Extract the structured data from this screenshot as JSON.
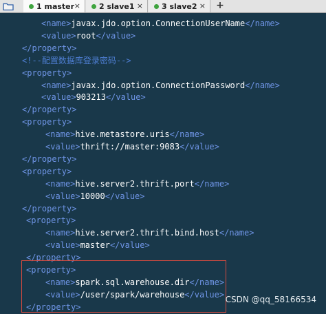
{
  "tabs": [
    {
      "label": "1 master",
      "close": "×"
    },
    {
      "label": "2 slave1",
      "close": "×"
    },
    {
      "label": "3 slave2",
      "close": "×"
    }
  ],
  "add_tab": "+",
  "code_lines": [
    [
      "<name>",
      "javax.jdo.option.ConnectionUserName",
      "</name>"
    ],
    [
      "<value>",
      "root",
      "</value>"
    ],
    [
      "</property>"
    ],
    [
      "<!--配置数据库登录密码-->"
    ],
    [
      "<property>"
    ],
    [
      "<name>",
      "javax.jdo.option.ConnectionPassword",
      "</name>"
    ],
    [
      "<value>",
      "903213",
      "</value>"
    ],
    [
      "</property>"
    ],
    [
      "<property>"
    ],
    [
      "<name>",
      "hive.metastore.uris",
      "</name>"
    ],
    [
      "<value>",
      "thrift://master:9083",
      "</value>"
    ],
    [
      "</property>"
    ],
    [
      "<property>"
    ],
    [
      "<name>",
      "hive.server2.thrift.port",
      "</name>"
    ],
    [
      "<value>",
      "10000",
      "</value>"
    ],
    [
      "</property>"
    ],
    [
      "<property>"
    ],
    [
      "<name>",
      "hive.server2.thrift.bind.host",
      "</name>"
    ],
    [
      "<value>",
      "master",
      "</value>"
    ],
    [
      "</property>"
    ],
    [
      "<property>"
    ],
    [
      "<name>",
      "spark.sql.warehouse.dir",
      "</name>"
    ],
    [
      "<value>",
      "/user/spark/warehouse",
      "</value>"
    ],
    [
      "</property>"
    ]
  ],
  "watermark": "CSDN @qq_58166534",
  "colors": {
    "background": "#19384a",
    "tag": "#6f95e6",
    "text": "#ffffff",
    "comment": "#4f7fd4",
    "highlight_border": "#d84b3f"
  }
}
